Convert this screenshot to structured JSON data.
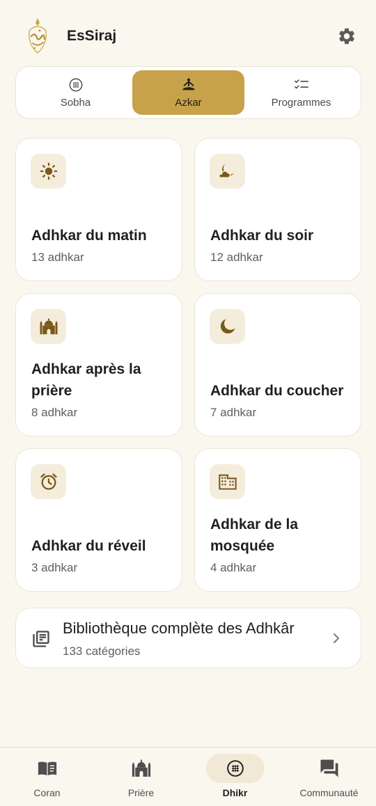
{
  "header": {
    "app_name": "EsSiraj",
    "logo": "essiraj-calligraphy-logo",
    "settings_icon": "gear-icon"
  },
  "tabs": [
    {
      "label": "Sobha",
      "icon": "tasbih-icon",
      "active": false
    },
    {
      "label": "Azkar",
      "icon": "meditation-icon",
      "active": true
    },
    {
      "label": "Programmes",
      "icon": "checklist-icon",
      "active": false
    }
  ],
  "cards": [
    {
      "title": "Adhkar du matin",
      "subtitle": "13 adhkar",
      "icon": "sun-icon"
    },
    {
      "title": "Adhkar du soir",
      "subtitle": "12 adhkar",
      "icon": "moon-cloud-icon"
    },
    {
      "title": "Adhkar après la prière",
      "subtitle": "8 adhkar",
      "icon": "mosque-icon"
    },
    {
      "title": "Adhkar du coucher",
      "subtitle": "7 adhkar",
      "icon": "moon-icon"
    },
    {
      "title": "Adhkar du réveil",
      "subtitle": "3 adhkar",
      "icon": "alarm-clock-icon"
    },
    {
      "title": "Adhkar de la mosquée",
      "subtitle": "4 adhkar",
      "icon": "building-icon"
    }
  ],
  "library": {
    "title": "Bibliothèque complète des Adhkâr",
    "subtitle": "133 catégories",
    "icon": "library-books-icon"
  },
  "bottom_nav": [
    {
      "label": "Coran",
      "icon": "book-icon",
      "active": false
    },
    {
      "label": "Prière",
      "icon": "mosque-icon",
      "active": false
    },
    {
      "label": "Dhikr",
      "icon": "tasbih-icon",
      "active": true
    },
    {
      "label": "Communauté",
      "icon": "chat-icon",
      "active": false
    }
  ],
  "colors": {
    "background": "#faf7ef",
    "accent": "#c7a24a",
    "icon_brown": "#7a5a1c",
    "icon_bg": "#f5eddb"
  }
}
